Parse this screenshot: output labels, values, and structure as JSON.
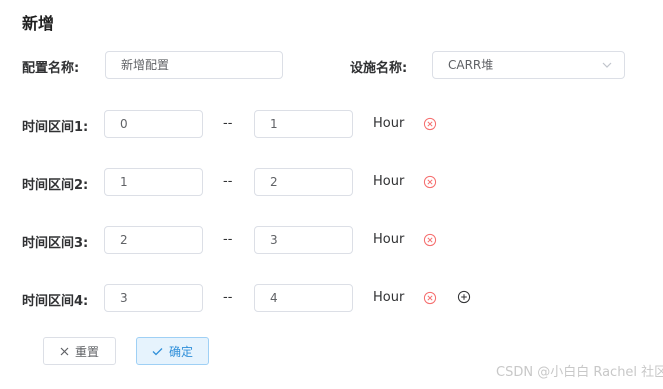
{
  "title": "新增",
  "config": {
    "name_label": "配置名称:",
    "name_value": "新增配置",
    "facility_label": "设施名称:",
    "facility_value": "CARR堆"
  },
  "intervals": [
    {
      "label": "时间区间1:",
      "from": "0",
      "to": "1"
    },
    {
      "label": "时间区间2:",
      "from": "1",
      "to": "2"
    },
    {
      "label": "时间区间3:",
      "from": "2",
      "to": "3"
    },
    {
      "label": "时间区间4:",
      "from": "3",
      "to": "4"
    }
  ],
  "separator": "--",
  "unit": "Hour",
  "buttons": {
    "reset": "重置",
    "confirm": "确定"
  },
  "watermark": "CSDN @小白白 Rachel 社区",
  "colors": {
    "remove_icon": "#f56c6c",
    "confirm_accent": "#2f8fd9"
  }
}
